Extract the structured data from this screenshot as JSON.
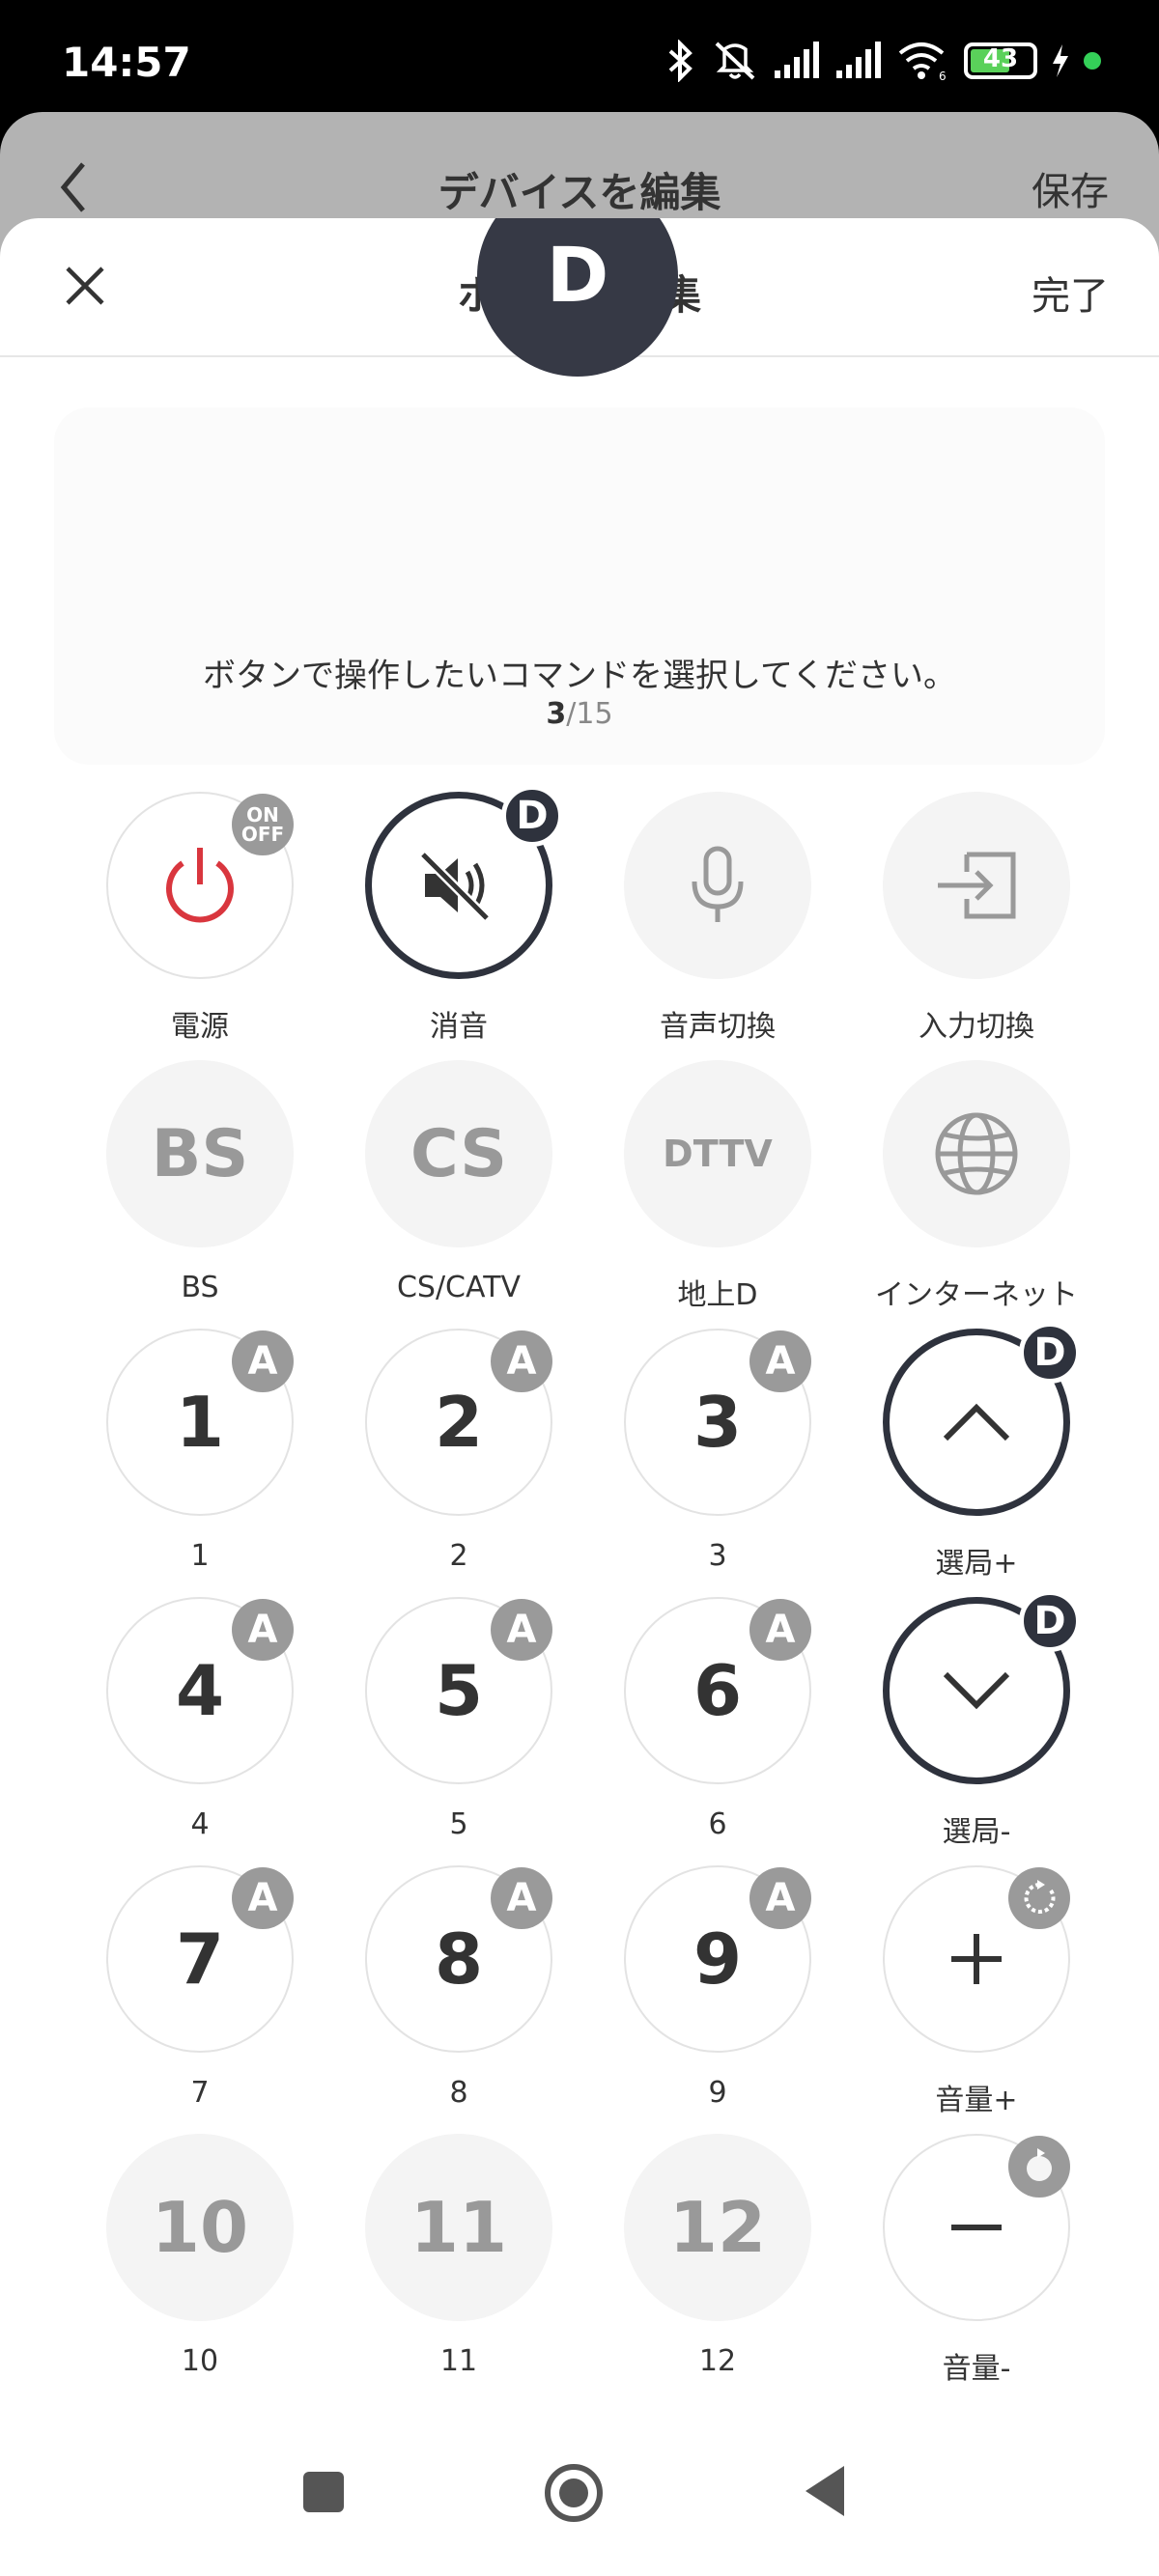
{
  "status_bar": {
    "time": "14:57",
    "battery": "43"
  },
  "parent": {
    "title": "デバイスを編集",
    "save_label": "保存"
  },
  "sheet": {
    "title": "ボタンを編集",
    "done_label": "完了"
  },
  "selected": {
    "letter": "D",
    "instruction": "ボタンで操作したいコマンドを選択してください。",
    "current": "3",
    "separator": "/",
    "total": "15"
  },
  "buttons": [
    {
      "label": "電源",
      "badge": "ON OFF"
    },
    {
      "label": "消音",
      "badge": "D"
    },
    {
      "label": "音声切換"
    },
    {
      "label": "入力切換"
    },
    {
      "label": "BS",
      "text": "BS"
    },
    {
      "label": "CS/CATV",
      "text": "CS"
    },
    {
      "label": "地上D",
      "text": "DTTV"
    },
    {
      "label": "インターネット"
    },
    {
      "label": "1",
      "text": "1",
      "badge": "A"
    },
    {
      "label": "2",
      "text": "2",
      "badge": "A"
    },
    {
      "label": "3",
      "text": "3",
      "badge": "A"
    },
    {
      "label": "選局+",
      "badge": "D"
    },
    {
      "label": "4",
      "text": "4",
      "badge": "A"
    },
    {
      "label": "5",
      "text": "5",
      "badge": "A"
    },
    {
      "label": "6",
      "text": "6",
      "badge": "A"
    },
    {
      "label": "選局-",
      "badge": "D"
    },
    {
      "label": "7",
      "text": "7",
      "badge": "A"
    },
    {
      "label": "8",
      "text": "8",
      "badge": "A"
    },
    {
      "label": "9",
      "text": "9",
      "badge": "A"
    },
    {
      "label": "音量+"
    },
    {
      "label": "10",
      "text": "10"
    },
    {
      "label": "11",
      "text": "11"
    },
    {
      "label": "12",
      "text": "12"
    },
    {
      "label": "音量-"
    }
  ],
  "colors": {
    "power_red": "#d9363e",
    "selected_dark": "#2e323d",
    "badge_gray": "#9a9a9a"
  }
}
